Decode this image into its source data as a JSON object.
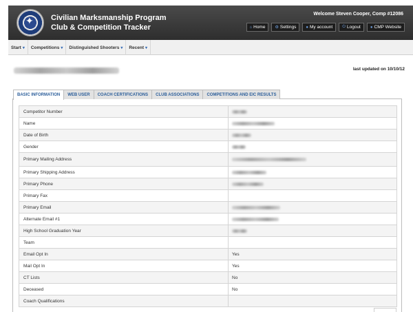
{
  "header": {
    "title_line1": "Civilian Marksmanship Program",
    "title_line2": "Club & Competition Tracker",
    "welcome": "Welcome Steven Cooper, Comp #12086",
    "buttons": [
      {
        "label": "Home",
        "icon": "home-icon"
      },
      {
        "label": "Settings",
        "icon": "settings-icon"
      },
      {
        "label": "My account",
        "icon": "user-icon"
      },
      {
        "label": "Logout",
        "icon": "power-icon"
      },
      {
        "label": "CMP Website",
        "icon": "globe-icon"
      }
    ]
  },
  "nav": {
    "items": [
      {
        "label": "Start"
      },
      {
        "label": "Competitions"
      },
      {
        "label": "Distinguished Shooters"
      },
      {
        "label": "Recent"
      }
    ]
  },
  "record": {
    "last_updated": "last updated on 10/10/12"
  },
  "tabs": [
    {
      "label": "BASIC INFORMATION",
      "active": true
    },
    {
      "label": "WEB USER",
      "active": false
    },
    {
      "label": "COACH CERTIFICATIONS",
      "active": false
    },
    {
      "label": "CLUB ASSOCIATIONS",
      "active": false
    },
    {
      "label": "COMPETITIONS AND EIC RESULTS",
      "active": false
    }
  ],
  "fields": [
    {
      "label": "Competitor Number",
      "value": "",
      "redacted": true
    },
    {
      "label": "Name",
      "value": "",
      "redacted": true
    },
    {
      "label": "Date of Birth",
      "value": "",
      "redacted": true
    },
    {
      "label": "Gender",
      "value": "",
      "redacted": true
    },
    {
      "label": "Primary Mailing Address",
      "value": "",
      "redacted": true
    },
    {
      "label": "Primary Shipping Address",
      "value": "",
      "redacted": true
    },
    {
      "label": "Primary Phone",
      "value": "",
      "redacted": true
    },
    {
      "label": "Primary Fax",
      "value": "",
      "redacted": false
    },
    {
      "label": "Primary Email",
      "value": "",
      "redacted": true
    },
    {
      "label": "Alternate Email #1",
      "value": "",
      "redacted": true
    },
    {
      "label": "High School Graduation Year",
      "value": "",
      "redacted": true
    },
    {
      "label": "Team",
      "value": "",
      "redacted": false
    },
    {
      "label": "Email Opt In",
      "value": "Yes",
      "redacted": false
    },
    {
      "label": "Mail Opt In",
      "value": "Yes",
      "redacted": false
    },
    {
      "label": "CT Lists",
      "value": "No",
      "redacted": false
    },
    {
      "label": "Deceased",
      "value": "No",
      "redacted": false
    },
    {
      "label": "Coach Qualifications",
      "value": "",
      "redacted": false
    }
  ],
  "colors": {
    "header_bg": "#3a3a3a",
    "tab_text": "#2a5d9a",
    "accent": "#3a6fb5"
  }
}
